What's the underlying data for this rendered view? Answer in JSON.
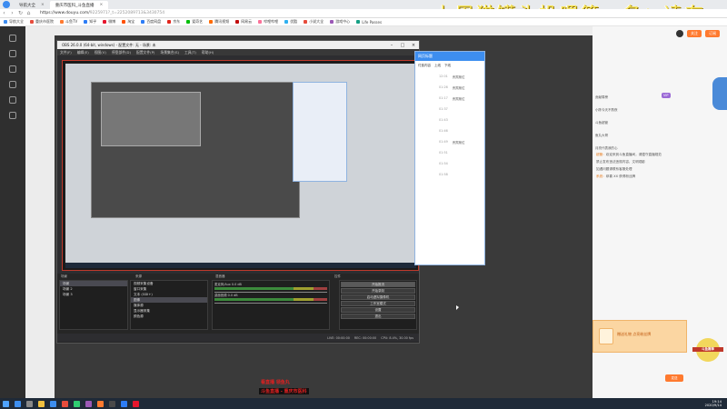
{
  "overlay": {
    "text": "上周猫罐头投喂第一名：凌布"
  },
  "browser": {
    "tabs": [
      {
        "label": "导航大全",
        "active": false
      },
      {
        "label": "重庆市医科_斗鱼直播",
        "active": true
      }
    ],
    "url": {
      "host": "https://www.douyu.com/",
      "rest": "9225971?_t=2252089713&3430754"
    },
    "bookmarks": [
      {
        "label": "导航大全",
        "color": "#3d8cf0"
      },
      {
        "label": "重庆市医院",
        "color": "#e74c3c"
      },
      {
        "label": "斗鱼TV",
        "color": "#ff7a2f"
      },
      {
        "label": "知乎",
        "color": "#2d7df6"
      },
      {
        "label": "微博",
        "color": "#e6162d"
      },
      {
        "label": "淘宝",
        "color": "#ff5000"
      },
      {
        "label": "百度网盘",
        "color": "#2d7df6"
      },
      {
        "label": "京东",
        "color": "#e1251b"
      },
      {
        "label": "爱奇艺",
        "color": "#00be06"
      },
      {
        "label": "腾讯视频",
        "color": "#ff6a00"
      },
      {
        "label": "网易云",
        "color": "#c20c0c"
      },
      {
        "label": "哔哩哔哩",
        "color": "#fb7299"
      },
      {
        "label": "优酷",
        "color": "#2fb0f0"
      },
      {
        "label": "小说大全",
        "color": "#e74c3c"
      },
      {
        "label": "游戏中心",
        "color": "#9b59b6"
      },
      {
        "label": "Life Passes",
        "color": "#16a085"
      }
    ]
  },
  "obs": {
    "title": "OBS 26.0.0 (64-bit, windows) - 配置文件: 无 - 场景: 未",
    "menu": [
      "文件(F)",
      "编辑(E)",
      "视图(V)",
      "停靠部件(D)",
      "配置文件(P)",
      "场景集合(S)",
      "工具(T)",
      "帮助(H)"
    ],
    "panels": {
      "scenes_header": "场景",
      "sources_header": "来源",
      "mixer_header": "混音器",
      "transitions_header": "场景过渡",
      "controls_header": "控件"
    },
    "scenes": [
      "场景",
      "场景 2",
      "场景 3"
    ],
    "sources": [
      "视频采集设备",
      "窗口采集",
      "文本 (GDI+)",
      "图像",
      "媒体源",
      "显示器采集",
      "颜色源"
    ],
    "mixer": [
      {
        "label": "麦克风/Aux",
        "level": "0.0 dB"
      },
      {
        "label": "桌面音频",
        "level": "0.0 dB"
      }
    ],
    "controls": [
      "开始推流",
      "开始录制",
      "启动虚拟摄像机",
      "工作室模式",
      "设置",
      "退出"
    ],
    "status": {
      "live": "LIVE: 00:00:00",
      "rec": "REC: 00:00:00",
      "cpu": "CPU: 8.4%, 30.00 fps"
    }
  },
  "blue_panel": {
    "header": "网页标题",
    "tabs": [
      "付费内容",
      "上线",
      "下线"
    ],
    "rows": [
      {
        "time": "12:01",
        "text": "贵宾席位"
      },
      {
        "time": "01:26",
        "text": "贵宾席位"
      },
      {
        "time": "01:17",
        "text": "贵宾席位"
      },
      {
        "time": "01:37",
        "text": ""
      },
      {
        "time": "01:43",
        "text": ""
      },
      {
        "time": "01:46",
        "text": ""
      },
      {
        "time": "01:49",
        "text": "贵宾席位"
      },
      {
        "time": "01:51",
        "text": ""
      },
      {
        "time": "01:54",
        "text": ""
      },
      {
        "time": "01:58",
        "text": ""
      }
    ]
  },
  "side": {
    "follow_label": "关注",
    "btn_label": "订阅",
    "rank_rows": [
      "贡献周榜",
      "小陈今天不熬夜",
      "斗鱼超管",
      "鱼丸大哥",
      "月亮代表我的心"
    ],
    "chat": [
      {
        "user": "超管：",
        "text": "欢迎来到斗鱼直播间，请遵守直播规范"
      },
      {
        "user": "",
        "text": "禁止发布违法违规内容，文明观影"
      },
      {
        "user": "",
        "text": "如遇问题请联系客服处理"
      },
      {
        "user": "系统：",
        "text": "恭喜 XX 获得粉丝牌"
      }
    ],
    "gift_text": "赠送礼物 点亮粉丝牌",
    "send_label": "发送",
    "mascot_text": "斗鱼赛季"
  },
  "subtitles": {
    "line1": "看直播 领鱼丸",
    "line2": "斗鱼直播 - 重庆市医科"
  },
  "taskbar": {
    "time": "19:14",
    "date": "2020/9/14",
    "apps": [
      "#3d8ef0",
      "#888888",
      "#f0c040",
      "#3d8ef0",
      "#e74c3c",
      "#2ecc71",
      "#9b59b6",
      "#ff7a2f",
      "#4a4a4a",
      "#2d7df6",
      "#e6162d"
    ]
  },
  "colors": {
    "accent": "#ff7a2f",
    "obs_bg": "#2d2d30",
    "preview_border": "#c0392b"
  }
}
